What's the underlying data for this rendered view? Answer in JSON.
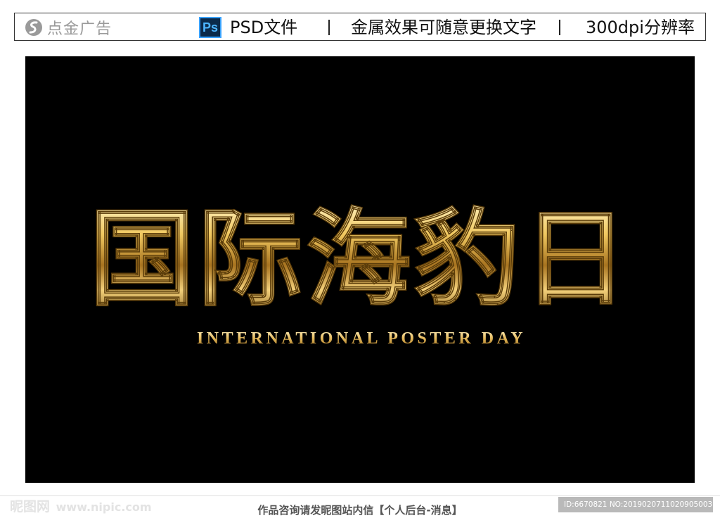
{
  "header": {
    "brand_name": "点金广告",
    "ps_badge": "Ps",
    "file_type": "PSD文件",
    "feature": "金属效果可随意更换文字",
    "resolution": "300dpi分辨率"
  },
  "artwork": {
    "title_cn": "国际海豹日",
    "subtitle_en": "INTERNATIONAL POSTER DAY",
    "colors": {
      "background": "#000000",
      "gold_light": "#fff1b8",
      "gold_mid": "#d8a83c",
      "gold_dark": "#6b4a10"
    }
  },
  "footer": {
    "watermark_site": "昵图网",
    "watermark_url": "www.nipic.com",
    "consult_text": "作品咨询请发昵图站内信【个人后台-消息】",
    "id_text": "ID:6670821 NO:20190207110209050030"
  }
}
